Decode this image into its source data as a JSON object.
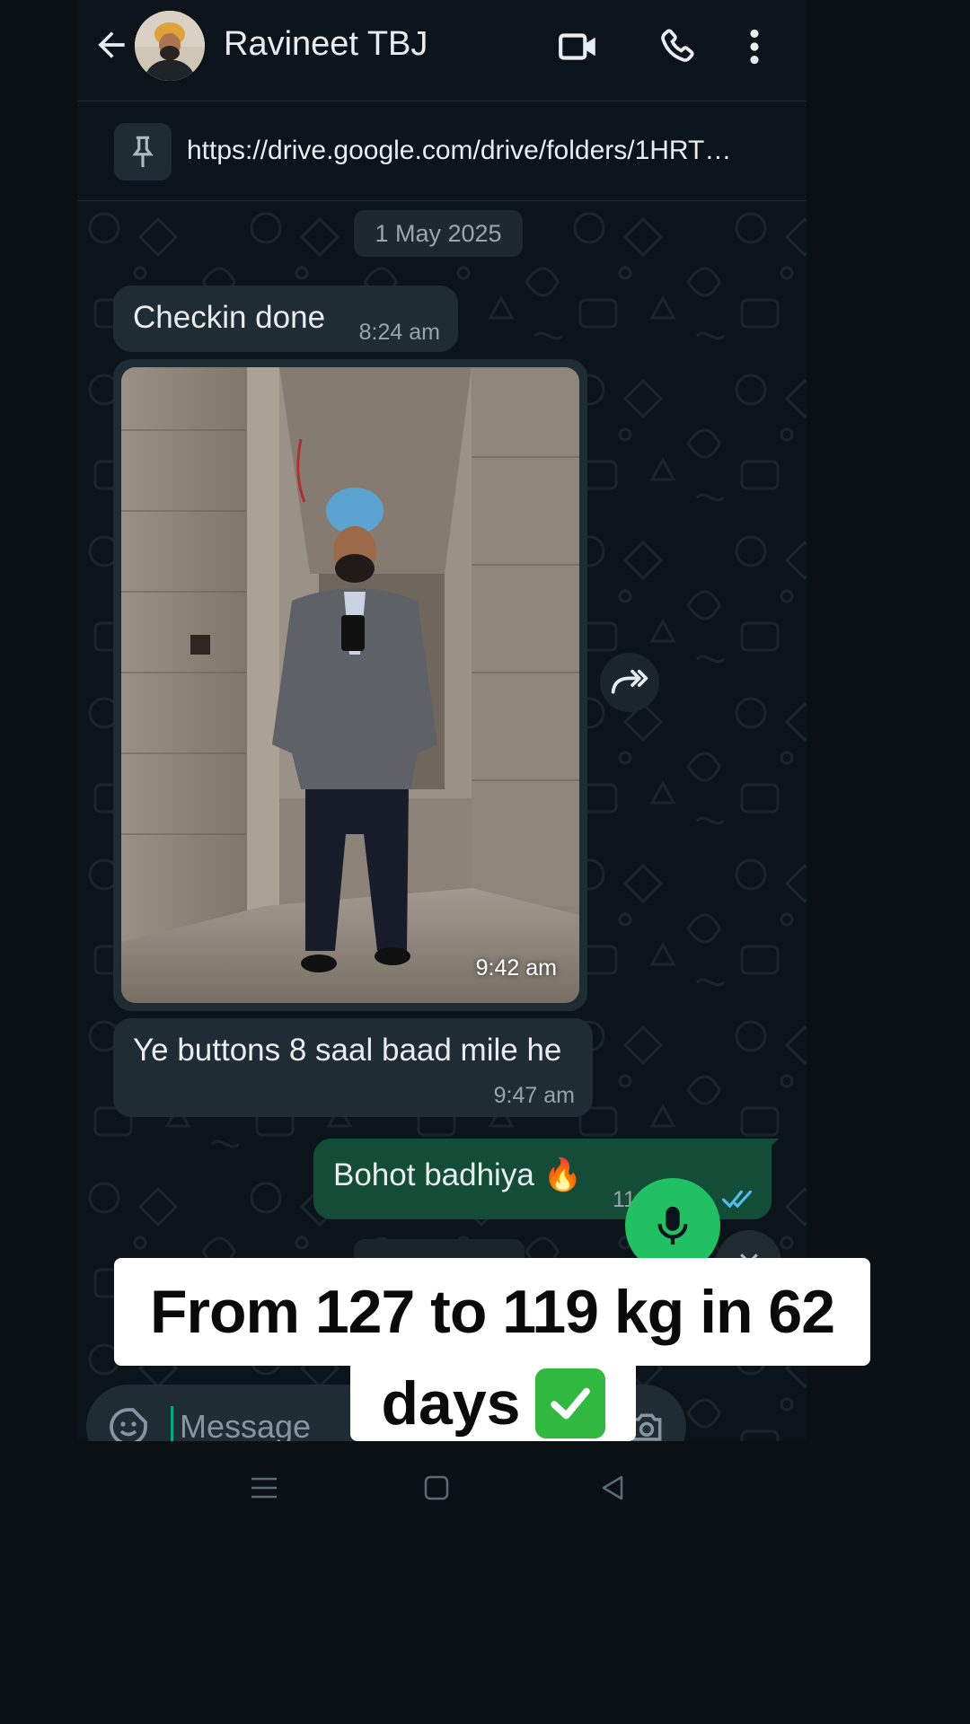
{
  "header": {
    "contact_name": "Ravineet TBJ",
    "icons": [
      "back-arrow-icon",
      "avatar",
      "video-call-icon",
      "voice-call-icon",
      "more-vert-icon"
    ]
  },
  "pinned": {
    "text": "https://drive.google.com/drive/folders/1HRT…",
    "icon": "pin-icon"
  },
  "chat": {
    "date_chip": "1 May 2025",
    "messages": [
      {
        "direction": "in",
        "text": "Checkin done",
        "time": "8:24 am"
      },
      {
        "direction": "in",
        "type": "image",
        "time": "9:42 am"
      },
      {
        "direction": "in",
        "text": "Ye buttons 8 saal baad mile he",
        "time": "9:47 am"
      },
      {
        "direction": "out",
        "text": "Bohot badhiya",
        "emoji": "🔥",
        "time": "11:50 am",
        "status": "read"
      }
    ]
  },
  "input": {
    "placeholder": "Message"
  },
  "caption": {
    "line1": "From 127 to 119 kg in 62",
    "line2": "days",
    "emoji": "✅"
  },
  "colors": {
    "app_bg": "#0b141a",
    "bubble_in": "#202c33",
    "bubble_out": "#144d37",
    "accent_green": "#21c063",
    "read_tick": "#53bdeb"
  }
}
